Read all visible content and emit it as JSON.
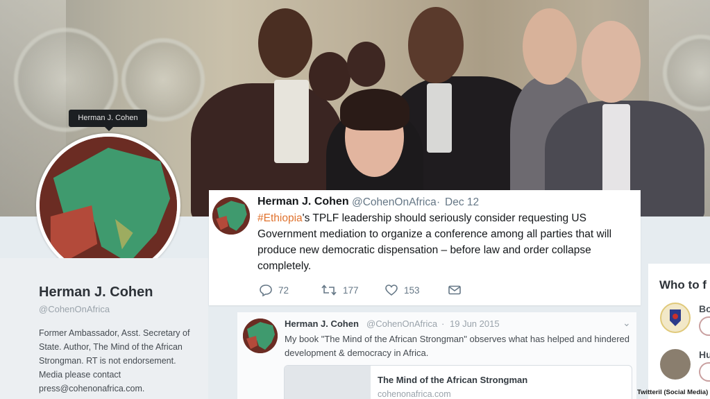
{
  "header": {
    "tooltip": "Herman J. Cohen"
  },
  "profile": {
    "name": "Herman J. Cohen",
    "handle": "@CohenOnAfrica",
    "bio_lines": [
      "Former Ambassador, Asst. Secretary of",
      "State. Author, The Mind of the African",
      "Strongman. RT is not endorsement.",
      "Media please contact",
      "press@cohenonafrica.com."
    ]
  },
  "main_tweet": {
    "name": "Herman J. Cohen",
    "handle": "@CohenOnAfrica",
    "separator": "·",
    "date": "Dec 12",
    "hashtag": "#Ethiopia",
    "text_after_hashtag": "'s TPLF leadership should seriously consider requesting US Government mediation to organize a conference among all parties that will produce new democratic dispensation – before law and order collapse completely.",
    "replies": "72",
    "retweets": "177",
    "likes": "153"
  },
  "second_tweet": {
    "name": "Herman J. Cohen",
    "handle": "@CohenOnAfrica",
    "separator": "·",
    "date": "19 Jun 2015",
    "chevron": "⌄",
    "text": "My book \"The Mind of the African Strongman\" observes what has helped and hindered development & democracy in Africa.",
    "card_title": "The Mind of the African Strongman",
    "card_domain": "cohenonafrica.com"
  },
  "who_to_follow": {
    "title": "Who to f",
    "items": [
      {
        "name": "Bo"
      },
      {
        "name": "Hu"
      }
    ]
  },
  "caption": "Twitteril (Social Media)",
  "colors": {
    "hashtag": "#e0722d",
    "avatar_map_green": "#3f9a6e",
    "avatar_background": "#6b2c23"
  }
}
